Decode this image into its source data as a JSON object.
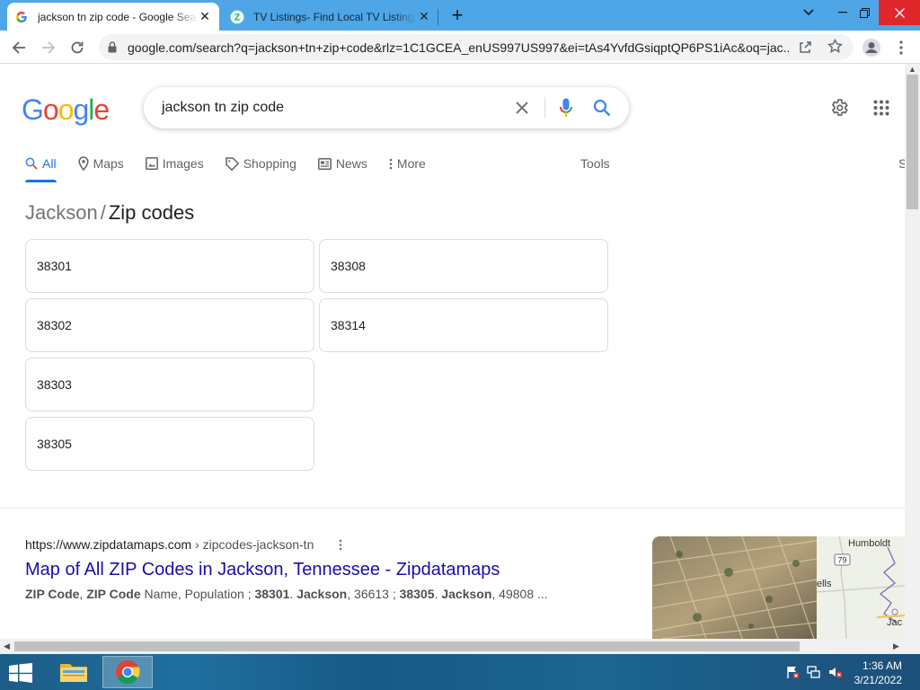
{
  "browser": {
    "tabs": [
      {
        "title": "jackson tn zip code - Google Search",
        "active": true
      },
      {
        "title": "TV Listings- Find Local TV Listings",
        "active": false
      }
    ],
    "address": "google.com/search?q=jackson+tn+zip+code&rlz=1C1GCEA_enUS997US997&ei=tAs4YvfdGsiqptQP6PS1iAc&oq=jac..."
  },
  "google": {
    "query": "jackson tn zip code",
    "nav_tabs": [
      "All",
      "Maps",
      "Images",
      "Shopping",
      "News",
      "More"
    ],
    "tools_label": "Tools",
    "clipped_label": "S",
    "breadcrumb": {
      "place": "Jackson",
      "separator": "/",
      "topic": "Zip codes"
    },
    "zip_codes": [
      "38301",
      "38308",
      "38302",
      "38314",
      "38303",
      "38305"
    ]
  },
  "result": {
    "site": "https://www.zipdatamaps.com",
    "path": " › zipcodes-jackson-tn",
    "title": "Map of All ZIP Codes in Jackson, Tennessee - Zipdatamaps",
    "snippet": {
      "zip_code": "ZIP Code",
      "comma": ", ",
      "zip_code_2": "ZIP Code",
      "mid": " Name, Population ; ",
      "z1": "38301",
      "dot1": ". ",
      "city1": "Jackson",
      "pop1": ", 36613 ; ",
      "z2": "38305",
      "dot2": ". ",
      "city2": "Jackson",
      "pop2": ", 49808 ..."
    },
    "map_labels": {
      "town": "Humboldt",
      "route": "79",
      "partial1": "ells",
      "partial2": "Jac"
    }
  },
  "taskbar": {
    "time": "1:36 AM",
    "date": "3/21/2022"
  },
  "colors": {
    "accent": "#1a73e8",
    "link": "#1a0dab",
    "tabstrip": "#4fa6e6"
  }
}
